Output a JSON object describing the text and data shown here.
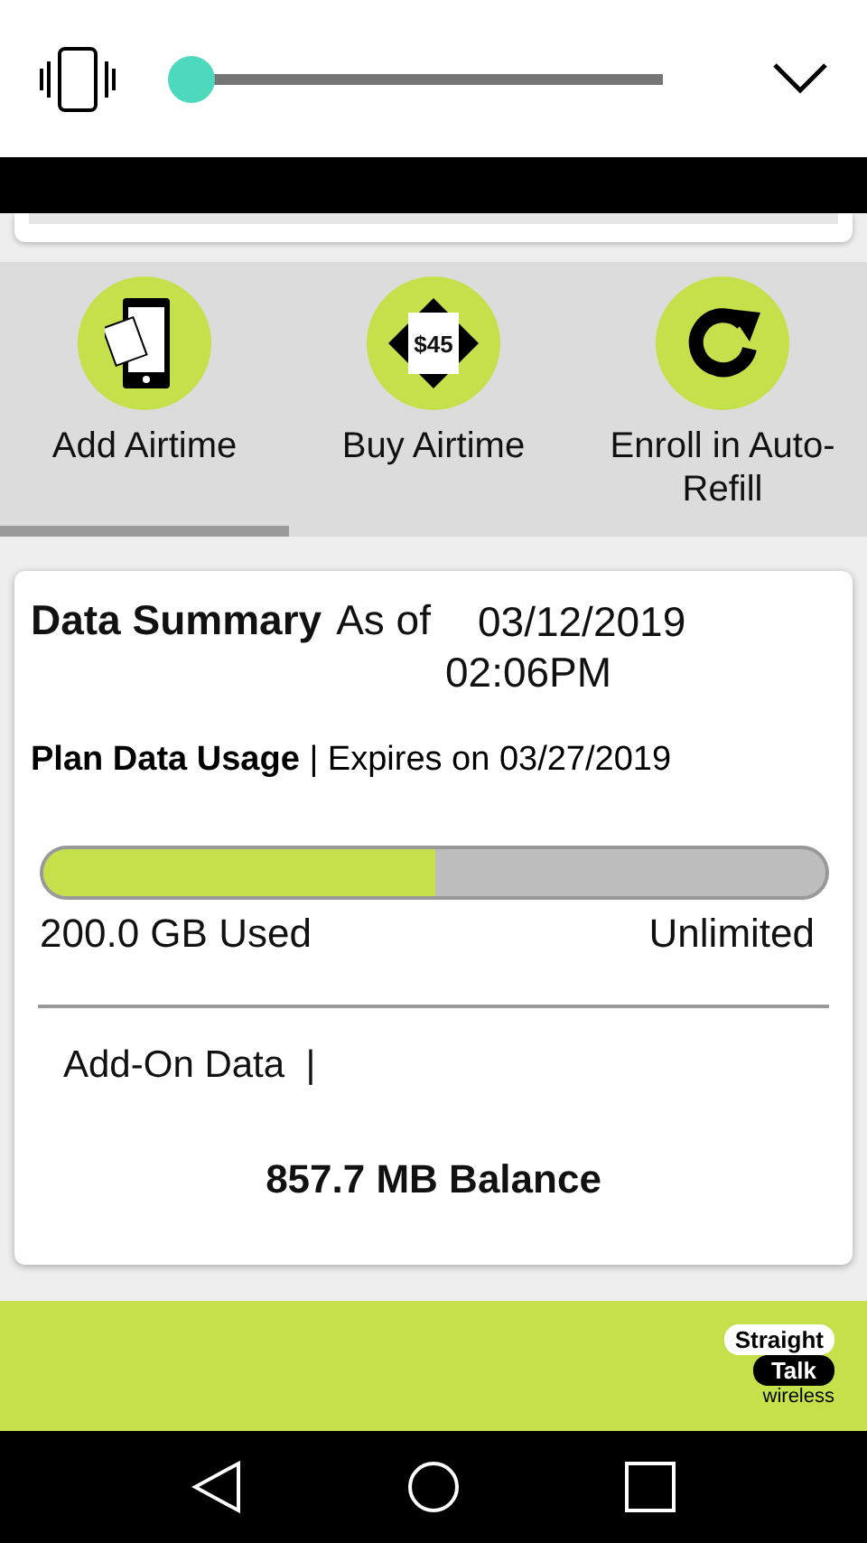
{
  "volume_panel": {
    "level": 0.04
  },
  "actions": [
    {
      "label": "Add Airtime",
      "kind": "phone",
      "selected": true
    },
    {
      "label": "Buy Airtime",
      "kind": "card",
      "card_text": "$45",
      "selected": false
    },
    {
      "label": "Enroll in Auto-Refill",
      "kind": "refresh",
      "selected": false
    }
  ],
  "data_summary": {
    "title": "Data Summary",
    "as_of_label": "As of",
    "date": "03/12/2019",
    "time": "02:06PM",
    "plan_label": "Plan Data Usage",
    "expires": "| Expires on 03/27/2019",
    "usage": {
      "level": 0.5,
      "used": "200.0 GB Used",
      "limit": "Unlimited"
    },
    "addon_label": "Add-On Data  |",
    "balance": "857.7 MB Balance"
  },
  "logo": {
    "line_1": "Straight",
    "line_2": "Talk",
    "line_3": "wireless"
  }
}
